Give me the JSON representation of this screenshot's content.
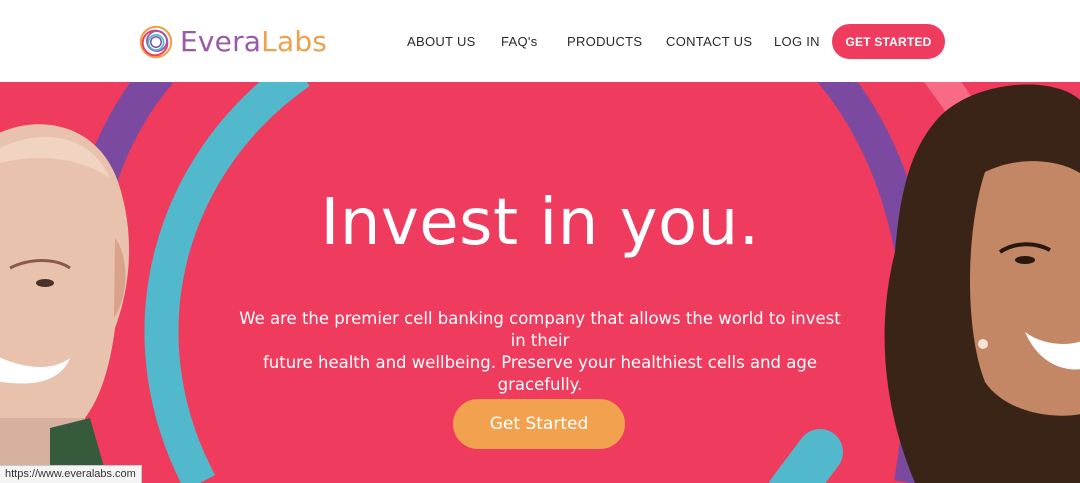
{
  "brand": {
    "name_part1": "Evera",
    "name_part2": "Labs",
    "colors": {
      "purple": "#9a5aa8",
      "orange": "#f0a04a",
      "pink": "#ef3b5d",
      "teal": "#52b9cc",
      "violet": "#7b4aa0"
    }
  },
  "nav": {
    "items": [
      {
        "label": "ABOUT US"
      },
      {
        "label": "FAQ's"
      },
      {
        "label": "PRODUCTS"
      },
      {
        "label": "CONTACT US"
      },
      {
        "label": "LOG IN"
      }
    ],
    "cta_label": "GET STARTED"
  },
  "hero": {
    "title": "Invest in you.",
    "subtitle_line1": "We are the premier cell banking company that allows the world to invest in their",
    "subtitle_line2": "future health and wellbeing. Preserve your healthiest cells and age gracefully.",
    "cta_label": "Get Started",
    "images": [
      "photo-older-man",
      "photo-smiling-woman"
    ]
  },
  "status_bar": {
    "url": "https://www.everalabs.com"
  }
}
